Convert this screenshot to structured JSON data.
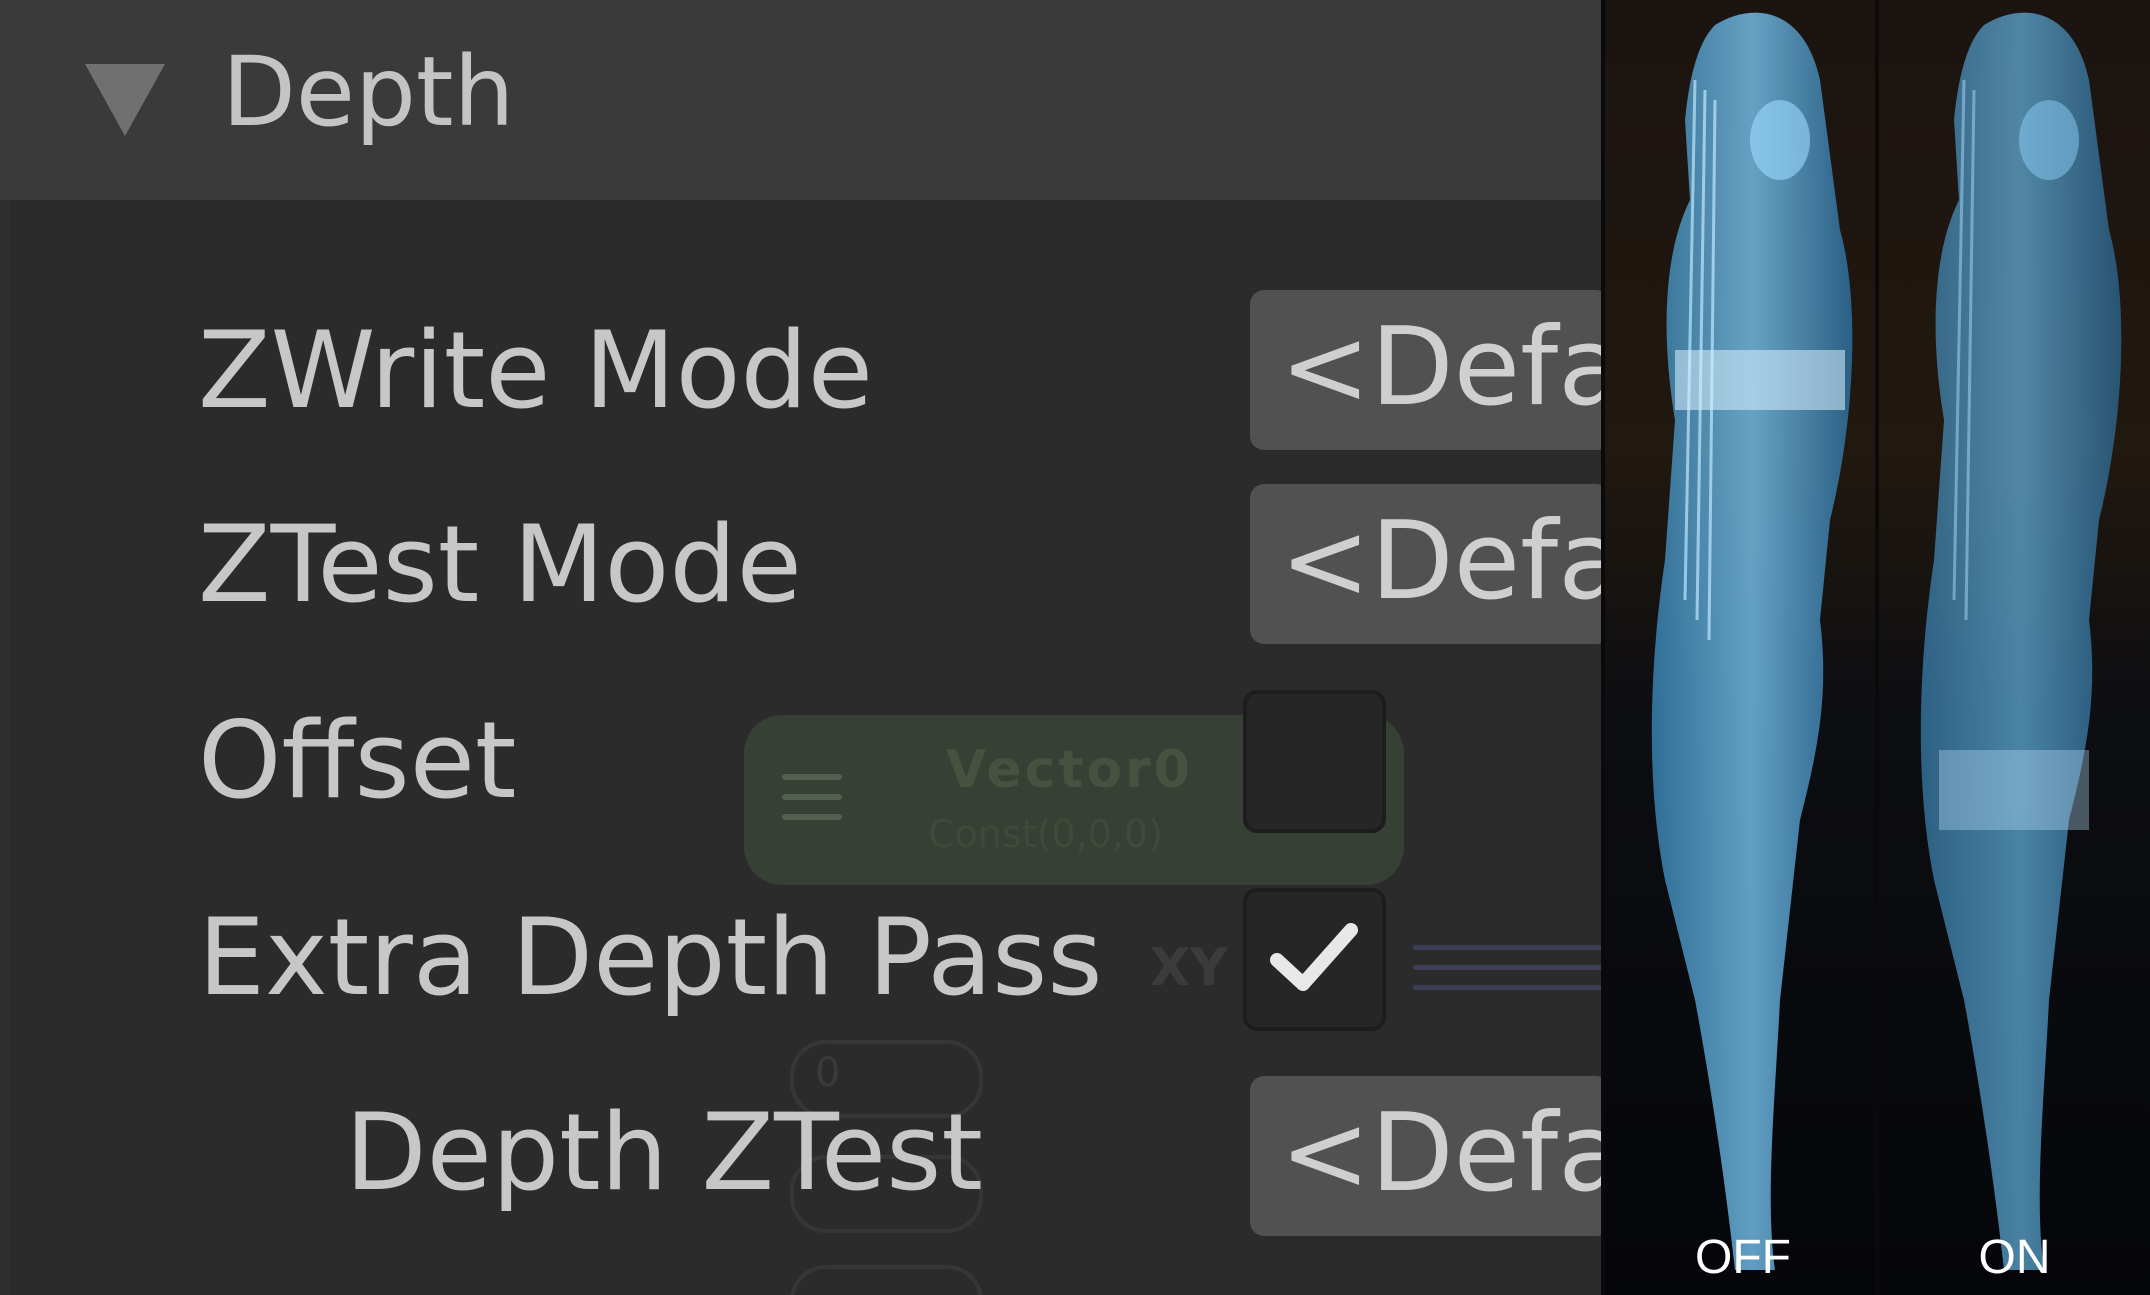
{
  "section": {
    "title": "Depth",
    "expanded": true
  },
  "properties": [
    {
      "label": "ZWrite Mode",
      "control": "dropdown",
      "value": "<Defa"
    },
    {
      "label": "ZTest Mode",
      "control": "dropdown",
      "value": "<Defa"
    },
    {
      "label": "Offset",
      "control": "checkbox",
      "checked": false
    },
    {
      "label": "Extra Depth Pass",
      "control": "checkbox",
      "checked": true
    },
    {
      "label": "Depth ZTest",
      "control": "dropdown",
      "value": "<Defa"
    }
  ],
  "background_node": {
    "title": "Vector0",
    "subtitle": "Const(0,0,0)",
    "port": "XY",
    "input_value": "0"
  },
  "previews": [
    {
      "caption": "OFF"
    },
    {
      "caption": "ON"
    }
  ],
  "colors": {
    "header_bg": "#3a3a3a",
    "panel_bg": "#2b2b2b",
    "hologram": "#5ab8f0"
  }
}
